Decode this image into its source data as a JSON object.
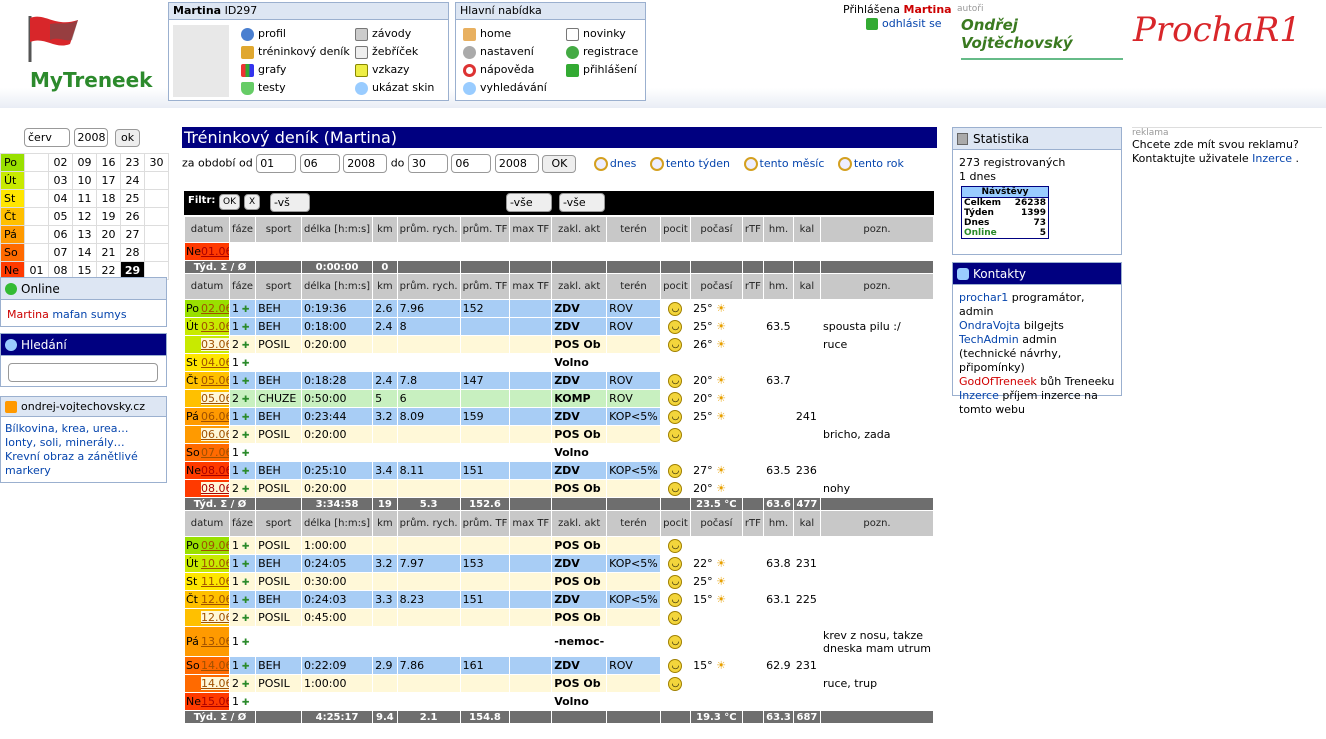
{
  "header": {
    "logo_text": "MyTreneek",
    "user_box_name": "Martina",
    "user_box_id": "ID297",
    "user_menu_left": [
      "profil",
      "tréninkový deník",
      "grafy",
      "testy"
    ],
    "user_menu_right": [
      "závody",
      "žebříček",
      "vzkazy",
      "ukázat skin"
    ],
    "main_menu_title": "Hlavní nabídka",
    "main_menu_left": [
      "home",
      "nastavení",
      "nápověda",
      "vyhledávání"
    ],
    "main_menu_right": [
      "novinky",
      "registrace",
      "přihlášení"
    ],
    "logged_label": "Přihlášena",
    "logged_user": "Martina",
    "logout": "odhlásit se",
    "authors_label": "autoři",
    "author1": "Ondřej Vojtěchovský",
    "author2": "ProchaR1"
  },
  "calendar": {
    "month": "červ",
    "year": "2008",
    "ok": "ok",
    "days": [
      "Po",
      "Út",
      "St",
      "Čt",
      "Pá",
      "So",
      "Ne"
    ],
    "rows": [
      [
        "",
        "02",
        "09",
        "16",
        "23",
        "30"
      ],
      [
        "",
        "03",
        "10",
        "17",
        "24",
        ""
      ],
      [
        "",
        "04",
        "11",
        "18",
        "25",
        ""
      ],
      [
        "",
        "05",
        "12",
        "19",
        "26",
        ""
      ],
      [
        "",
        "06",
        "13",
        "20",
        "27",
        ""
      ],
      [
        "",
        "07",
        "14",
        "21",
        "28",
        ""
      ],
      [
        "01",
        "08",
        "15",
        "22",
        "29",
        ""
      ]
    ]
  },
  "online": {
    "title": "Online",
    "users": [
      "Martina",
      "mafan",
      "sumys"
    ]
  },
  "search": {
    "title": "Hledání",
    "placeholder": ""
  },
  "rss": {
    "title": "ondrej-vojtechovsky.cz",
    "links": [
      "Bílkovina, krea, urea…",
      "Ionty, soli, minerály…",
      "Krevní obraz a zánětlivé markery"
    ]
  },
  "page": {
    "title": "Tréninkový deník (Martina)",
    "period_label": "za období od",
    "from_d": "01",
    "from_m": "06",
    "from_y": "2008",
    "to_label": "do",
    "to_d": "30",
    "to_m": "06",
    "to_y": "2008",
    "ok": "OK",
    "quick": [
      "dnes",
      "tento týden",
      "tento měsíc",
      "tento rok"
    ],
    "filter_label": "Filtr:",
    "filter_ok": "OK",
    "filter_x": "X",
    "f_sport": "-vš",
    "f_zakl": "-vše",
    "f_teren": "-vše"
  },
  "columns": [
    "datum",
    "fáze",
    "sport",
    "délka [h:m:s]",
    "km",
    "prům. rych.",
    "prům. TF",
    "max TF",
    "zakl. akt",
    "terén",
    "pocit",
    "počasí",
    "rTF",
    "hm.",
    "kal",
    "pozn."
  ],
  "week1": {
    "rows": [
      {
        "day": "Ne",
        "date": "01.06.",
        "color": "#ff3a00",
        "faze": "",
        "sport": "",
        "delka": "",
        "km": "",
        "rych": "",
        "tf": "",
        "zakl": "",
        "teren": "",
        "pocit": "",
        "pocasi": "",
        "hm": "",
        "kal": "",
        "pozn": ""
      }
    ],
    "sum": {
      "label": "Týd. Σ / Ø",
      "delka": "0:00:00",
      "km": "0",
      "rych": "",
      "tf": "",
      "pocasi": "",
      "hm": "",
      "kal": ""
    }
  },
  "week2": {
    "rows": [
      {
        "day": "Po",
        "date": "02.06.",
        "color": "#99e000",
        "faze": "1",
        "sport": "BEH",
        "delka": "0:19:36",
        "km": "2.6",
        "rych": "7.96",
        "tf": "152",
        "zakl": "ZDV",
        "teren": "ROV",
        "pocit": "y",
        "pocasi": "25°",
        "hm": "",
        "kal": "",
        "pozn": "",
        "bg": "#a8cdf5"
      },
      {
        "day": "Út",
        "date": "03.06.",
        "color": "#c8ea00",
        "faze": "1",
        "sport": "BEH",
        "delka": "0:18:00",
        "km": "2.4",
        "rych": "8",
        "tf": "",
        "zakl": "ZDV",
        "teren": "ROV",
        "pocit": "y",
        "pocasi": "25°",
        "hm": "63.5",
        "kal": "",
        "pozn": "spousta pilu :/",
        "bg": "#a8cdf5"
      },
      {
        "day": "",
        "date": "03.06.",
        "color": "#c8ea00",
        "faze": "2",
        "sport": "POSIL",
        "delka": "0:20:00",
        "km": "",
        "rych": "",
        "tf": "",
        "zakl": "POS Ob",
        "teren": "",
        "pocit": "y",
        "pocasi": "26°",
        "hm": "",
        "kal": "",
        "pozn": "ruce",
        "bg": "#fff8d8"
      },
      {
        "day": "St",
        "date": "04.06.",
        "color": "#ffe600",
        "faze": "1",
        "sport": "",
        "delka": "",
        "km": "",
        "rych": "",
        "tf": "",
        "zakl": "Volno",
        "teren": "",
        "pocit": "",
        "pocasi": "",
        "hm": "",
        "kal": "",
        "pozn": "",
        "bg": "#fff"
      },
      {
        "day": "Čt",
        "date": "05.06.",
        "color": "#ffc000",
        "faze": "1",
        "sport": "BEH",
        "delka": "0:18:28",
        "km": "2.4",
        "rych": "7.8",
        "tf": "147",
        "zakl": "ZDV",
        "teren": "ROV",
        "pocit": "y",
        "pocasi": "20°",
        "hm": "63.7",
        "kal": "",
        "pozn": "",
        "bg": "#a8cdf5"
      },
      {
        "day": "",
        "date": "05.06.",
        "color": "#ffc000",
        "faze": "2",
        "sport": "CHUZE",
        "delka": "0:50:00",
        "km": "5",
        "rych": "6",
        "tf": "",
        "zakl": "KOMP",
        "teren": "ROV",
        "pocit": "y",
        "pocasi": "20°",
        "hm": "",
        "kal": "",
        "pozn": "",
        "bg": "#c8f0c0"
      },
      {
        "day": "Pá",
        "date": "06.06.",
        "color": "#ff9a00",
        "faze": "1",
        "sport": "BEH",
        "delka": "0:23:44",
        "km": "3.2",
        "rych": "8.09",
        "tf": "159",
        "zakl": "ZDV",
        "teren": "KOP<5%",
        "pocit": "y",
        "pocasi": "25°",
        "hm": "",
        "kal": "241",
        "pozn": "",
        "bg": "#a8cdf5"
      },
      {
        "day": "",
        "date": "06.06.",
        "color": "#ff9a00",
        "faze": "2",
        "sport": "POSIL",
        "delka": "0:20:00",
        "km": "",
        "rych": "",
        "tf": "",
        "zakl": "POS Ob",
        "teren": "",
        "pocit": "y",
        "pocasi": "",
        "hm": "",
        "kal": "",
        "pozn": "bricho, zada",
        "bg": "#fff8d8"
      },
      {
        "day": "So",
        "date": "07.06.",
        "color": "#ff6a00",
        "faze": "1",
        "sport": "",
        "delka": "",
        "km": "",
        "rych": "",
        "tf": "",
        "zakl": "Volno",
        "teren": "",
        "pocit": "",
        "pocasi": "",
        "hm": "",
        "kal": "",
        "pozn": "",
        "bg": "#fff"
      },
      {
        "day": "Ne",
        "date": "08.06.",
        "color": "#ff3a00",
        "faze": "1",
        "sport": "BEH",
        "delka": "0:25:10",
        "km": "3.4",
        "rych": "8.11",
        "tf": "151",
        "zakl": "ZDV",
        "teren": "KOP<5%",
        "pocit": "y",
        "pocasi": "27°",
        "hm": "63.5",
        "kal": "236",
        "pozn": "",
        "bg": "#a8cdf5"
      },
      {
        "day": "",
        "date": "08.06.",
        "color": "#ff3a00",
        "faze": "2",
        "sport": "POSIL",
        "delka": "0:20:00",
        "km": "",
        "rych": "",
        "tf": "",
        "zakl": "POS Ob",
        "teren": "",
        "pocit": "y",
        "pocasi": "20°",
        "hm": "",
        "kal": "",
        "pozn": "nohy",
        "bg": "#fff8d8"
      }
    ],
    "sum": {
      "label": "Týd. Σ / Ø",
      "delka": "3:34:58",
      "km": "19",
      "rych": "5.3",
      "tf": "152.6",
      "pocasi": "23.5 °C",
      "hm": "63.6",
      "kal": "477"
    }
  },
  "week3": {
    "rows": [
      {
        "day": "Po",
        "date": "09.06.",
        "color": "#99e000",
        "faze": "1",
        "sport": "POSIL",
        "delka": "1:00:00",
        "km": "",
        "rych": "",
        "tf": "",
        "zakl": "POS Ob",
        "teren": "",
        "pocit": "y",
        "pocasi": "",
        "hm": "",
        "kal": "",
        "pozn": "",
        "bg": "#fff8d8"
      },
      {
        "day": "Út",
        "date": "10.06.",
        "color": "#c8ea00",
        "faze": "1",
        "sport": "BEH",
        "delka": "0:24:05",
        "km": "3.2",
        "rych": "7.97",
        "tf": "153",
        "zakl": "ZDV",
        "teren": "KOP<5%",
        "pocit": "y",
        "pocasi": "22°",
        "hm": "63.8",
        "kal": "231",
        "pozn": "",
        "bg": "#a8cdf5"
      },
      {
        "day": "St",
        "date": "11.06.",
        "color": "#ffe600",
        "faze": "1",
        "sport": "POSIL",
        "delka": "0:30:00",
        "km": "",
        "rych": "",
        "tf": "",
        "zakl": "POS Ob",
        "teren": "",
        "pocit": "y",
        "pocasi": "25°",
        "hm": "",
        "kal": "",
        "pozn": "",
        "bg": "#fff8d8"
      },
      {
        "day": "Čt",
        "date": "12.06.",
        "color": "#ffc000",
        "faze": "1",
        "sport": "BEH",
        "delka": "0:24:03",
        "km": "3.3",
        "rych": "8.23",
        "tf": "151",
        "zakl": "ZDV",
        "teren": "KOP<5%",
        "pocit": "y",
        "pocasi": "15°",
        "hm": "63.1",
        "kal": "225",
        "pozn": "",
        "bg": "#a8cdf5"
      },
      {
        "day": "",
        "date": "12.06.",
        "color": "#ffc000",
        "faze": "2",
        "sport": "POSIL",
        "delka": "0:45:00",
        "km": "",
        "rych": "",
        "tf": "",
        "zakl": "POS Ob",
        "teren": "",
        "pocit": "y",
        "pocasi": "",
        "hm": "",
        "kal": "",
        "pozn": "",
        "bg": "#fff8d8"
      },
      {
        "day": "Pá",
        "date": "13.06.",
        "color": "#ff9a00",
        "faze": "1",
        "sport": "",
        "delka": "",
        "km": "",
        "rych": "",
        "tf": "",
        "zakl": "-nemoc-",
        "teren": "",
        "pocit": "y",
        "pocasi": "",
        "hm": "",
        "kal": "",
        "pozn": "krev z nosu, takze dneska mam utrum",
        "bg": "#fff",
        "tall": true
      },
      {
        "day": "So",
        "date": "14.06.",
        "color": "#ff6a00",
        "faze": "1",
        "sport": "BEH",
        "delka": "0:22:09",
        "km": "2.9",
        "rych": "7.86",
        "tf": "161",
        "zakl": "ZDV",
        "teren": "ROV",
        "pocit": "y",
        "pocasi": "15°",
        "hm": "62.9",
        "kal": "231",
        "pozn": "",
        "bg": "#a8cdf5"
      },
      {
        "day": "",
        "date": "14.06.",
        "color": "#ff6a00",
        "faze": "2",
        "sport": "POSIL",
        "delka": "1:00:00",
        "km": "",
        "rych": "",
        "tf": "",
        "zakl": "POS Ob",
        "teren": "",
        "pocit": "y",
        "pocasi": "",
        "hm": "",
        "kal": "",
        "pozn": "ruce, trup",
        "bg": "#fff8d8"
      },
      {
        "day": "Ne",
        "date": "15.06.",
        "color": "#ff3a00",
        "faze": "1",
        "sport": "",
        "delka": "",
        "km": "",
        "rych": "",
        "tf": "",
        "zakl": "Volno",
        "teren": "",
        "pocit": "",
        "pocasi": "",
        "hm": "",
        "kal": "",
        "pozn": "",
        "bg": "#fff"
      }
    ],
    "sum": {
      "label": "Týd. Σ / Ø",
      "delka": "4:25:17",
      "km": "9.4",
      "rych": "2.1",
      "tf": "154.8",
      "pocasi": "19.3 °C",
      "hm": "63.3",
      "kal": "687"
    }
  },
  "stats": {
    "title": "Statistika",
    "line1": "273 registrovaných",
    "line2": "1 dnes",
    "visits_title": "Návštěvy",
    "visits": [
      [
        "Celkem",
        "26238"
      ],
      [
        "Týden",
        "1399"
      ],
      [
        "Dnes",
        "73"
      ],
      [
        "Online",
        "5"
      ]
    ]
  },
  "contacts": {
    "title": "Kontakty",
    "items": [
      {
        "name": "prochar1",
        "desc": "programátor, admin",
        "color": "#0645ad"
      },
      {
        "name": "OndraVojta",
        "desc": "bilgejts",
        "color": "#0645ad"
      },
      {
        "name": "TechAdmin",
        "desc": "admin (technické návrhy, připomínky)",
        "color": "#0645ad"
      },
      {
        "name": "GodOfTreneek",
        "desc": "bůh Treneeku",
        "color": "#d00000"
      },
      {
        "name": "Inzerce",
        "desc": "příjem inzerce na tomto webu",
        "color": "#0645ad"
      }
    ]
  },
  "ad": {
    "label": "reklama",
    "text": "Chcete zde mít svou reklamu? Kontaktujte uživatele",
    "link": "Inzerce",
    "tail": "."
  }
}
